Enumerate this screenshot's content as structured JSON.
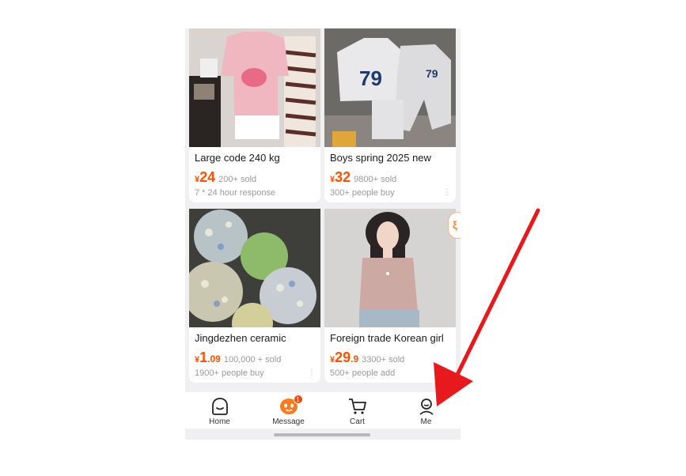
{
  "products": [
    {
      "title": "Large code 240 kg",
      "currency": "¥",
      "price_int": "24",
      "price_dec": "",
      "sold": "200+ sold",
      "meta": "7 * 24 hour response",
      "image": "pink-sweater-photo"
    },
    {
      "title": "Boys spring 2025 new",
      "currency": "¥",
      "price_int": "32",
      "price_dec": "",
      "sold": "9800+ sold",
      "meta": "300+ people buy",
      "image": "kids-tracksuit-79-photo"
    },
    {
      "title": "Jingdezhen ceramic",
      "currency": "¥",
      "price_int": "1",
      "price_dec": ".09",
      "sold": "100,000 + sold",
      "meta": "1900+ people buy",
      "image": "ceramic-flowers-photo"
    },
    {
      "title": "Foreign trade Korean girl",
      "currency": "¥",
      "price_int": "29",
      "price_dec": ".9",
      "sold": "3300+ sold",
      "meta": "500+ people add",
      "image": "pink-top-model-photo"
    }
  ],
  "more_dots": "⋮",
  "tabbar": {
    "home": "Home",
    "message": "Message",
    "message_badge": "1",
    "cart": "Cart",
    "me": "Me"
  },
  "side_pill_text": "ξ",
  "colors": {
    "accent": "#ff5000",
    "arrow": "#e8191c"
  }
}
